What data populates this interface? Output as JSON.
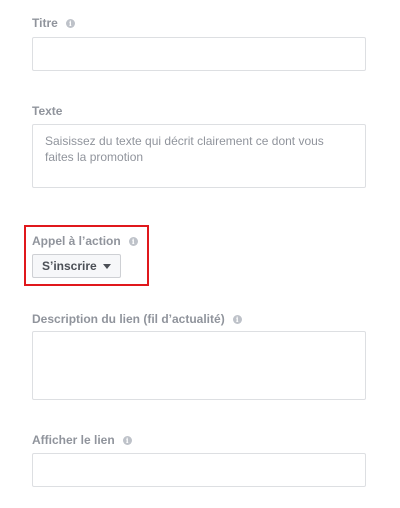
{
  "fields": {
    "title": {
      "label": "Titre",
      "value": ""
    },
    "text": {
      "label": "Texte",
      "placeholder": "Saisissez du texte qui décrit clairement ce dont vous faites la promotion"
    },
    "cta": {
      "label": "Appel à l’action",
      "selected": "S’inscrire"
    },
    "link_description": {
      "label": "Description du lien (fil d’actualité)",
      "value": ""
    },
    "display_link": {
      "label": "Afficher le lien",
      "value": ""
    }
  },
  "icons": {
    "info": "info-icon",
    "caret": "caret-down-icon"
  },
  "colors": {
    "highlight": "#e0181c",
    "label": "#90949c",
    "border": "#dddfe2"
  }
}
